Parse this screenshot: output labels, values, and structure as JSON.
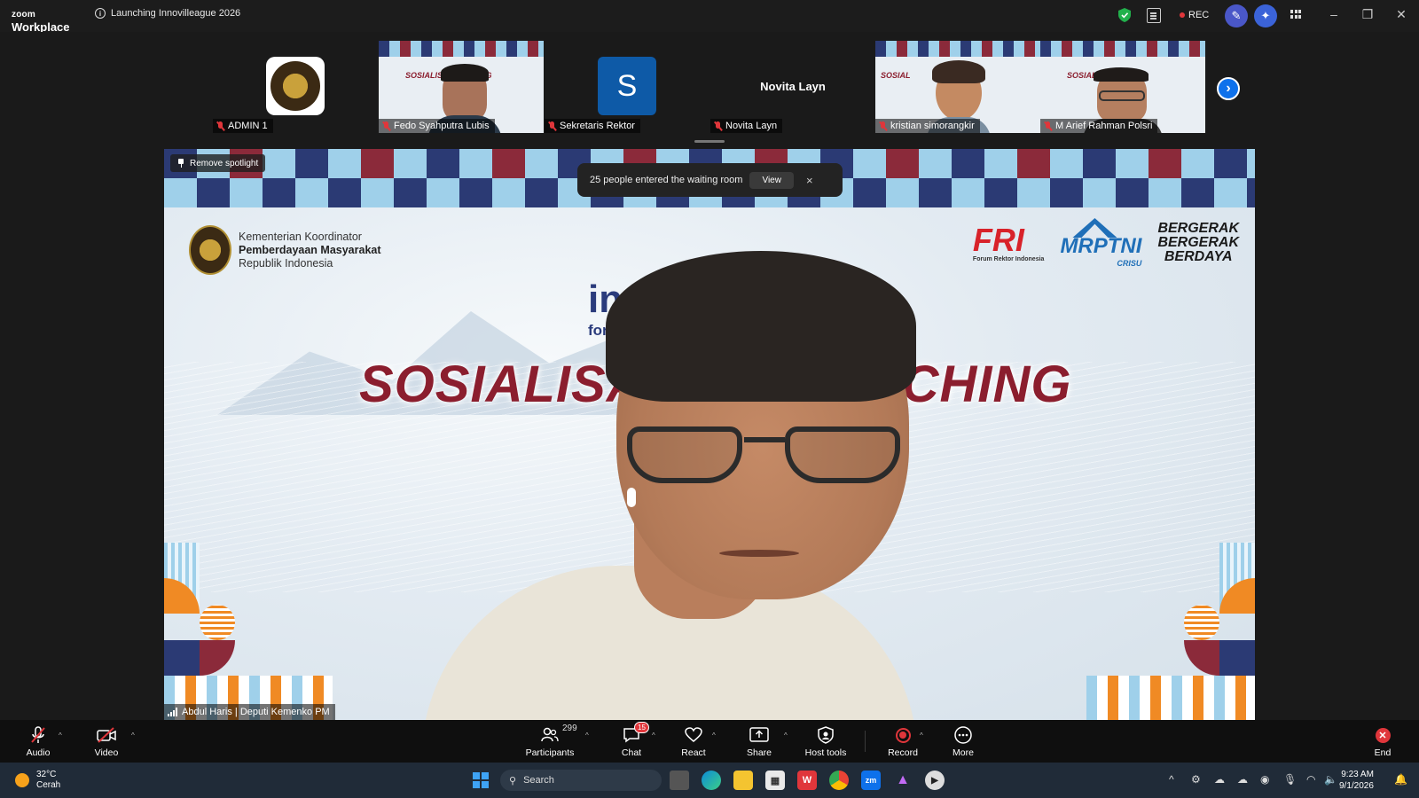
{
  "app": {
    "brand_small": "zoom",
    "brand_large": "Workplace",
    "meeting_title": "Launching Innovilleague 2026",
    "rec_label": "REC"
  },
  "participants": [
    {
      "name": "ADMIN 1",
      "type": "avatar-logo"
    },
    {
      "name": "Fedo Syahputra Lubis",
      "type": "video"
    },
    {
      "name": "Sekretaris Rektor",
      "type": "initial",
      "initial": "S"
    },
    {
      "name": "Novita Layn",
      "type": "name-only",
      "display": "Novita Layn"
    },
    {
      "name": "kristian simorangkir",
      "type": "video"
    },
    {
      "name": "M Arief Rahman Polsri",
      "type": "video"
    }
  ],
  "main_video": {
    "spotlight_label": "Remove spotlight",
    "speaker_name": "Abdul Haris | Deputi Kemenko PM",
    "slide": {
      "ministry_line1": "Kementerian Koordinator",
      "ministry_line2": "Pemberdayaan Masyarakat",
      "ministry_line3": "Republik Indonesia",
      "fri": "FRI",
      "fri_sub": "Forum Rektor Indonesia",
      "mrptni": "MRPTNI",
      "mrptni_sub": "CRISU",
      "bergerak1": "BERGERAK",
      "bergerak2": "BERGERAK",
      "berdaya": "BERDAYA",
      "inno": "inno",
      "inno_sub": "for Un",
      "headline_left": "SOSIALISA",
      "headline_right": "CHING"
    }
  },
  "toast": {
    "message": "25 people entered the waiting room",
    "view_label": "View",
    "close": "×"
  },
  "toolbar": {
    "audio": "Audio",
    "video": "Video",
    "participants": "Participants",
    "participants_count": "299",
    "chat": "Chat",
    "chat_badge": "15",
    "react": "React",
    "share": "Share",
    "host_tools": "Host tools",
    "record": "Record",
    "more": "More",
    "end": "End"
  },
  "taskbar": {
    "temperature": "32°C",
    "weather": "Cerah",
    "search_placeholder": "Search",
    "time": "9:23 AM",
    "date": "9/1/2026"
  },
  "colors": {
    "zoom_blue": "#0e71eb",
    "alert_red": "#e0363b",
    "slide_red": "#8b1e2e",
    "slide_navy": "#2a3b7c"
  }
}
